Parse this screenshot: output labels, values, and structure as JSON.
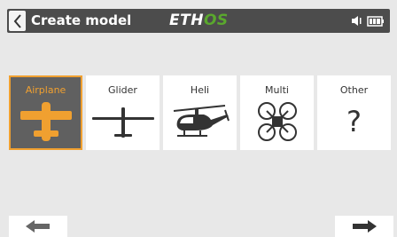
{
  "header": {
    "title": "Create model",
    "logo_prefix": "ETH",
    "logo_suffix": "OS"
  },
  "colors": {
    "title_bar": "#4c4c4c",
    "accent": "#f0a030",
    "logo_green": "#5aa82d",
    "background": "#e8e8e8",
    "tile": "#ffffff",
    "selected_tile": "#606060"
  },
  "model_types": [
    {
      "label": "Airplane",
      "icon": "airplane-icon",
      "selected": true
    },
    {
      "label": "Glider",
      "icon": "glider-icon",
      "selected": false
    },
    {
      "label": "Heli",
      "icon": "helicopter-icon",
      "selected": false
    },
    {
      "label": "Multi",
      "icon": "multirotor-icon",
      "selected": false
    },
    {
      "label": "Other",
      "icon": "question-mark-icon",
      "glyph": "?",
      "selected": false
    }
  ],
  "nav": {
    "prev_icon": "arrow-left-icon",
    "next_icon": "arrow-right-icon"
  },
  "status_icons": [
    "speaker-icon",
    "battery-icon"
  ]
}
